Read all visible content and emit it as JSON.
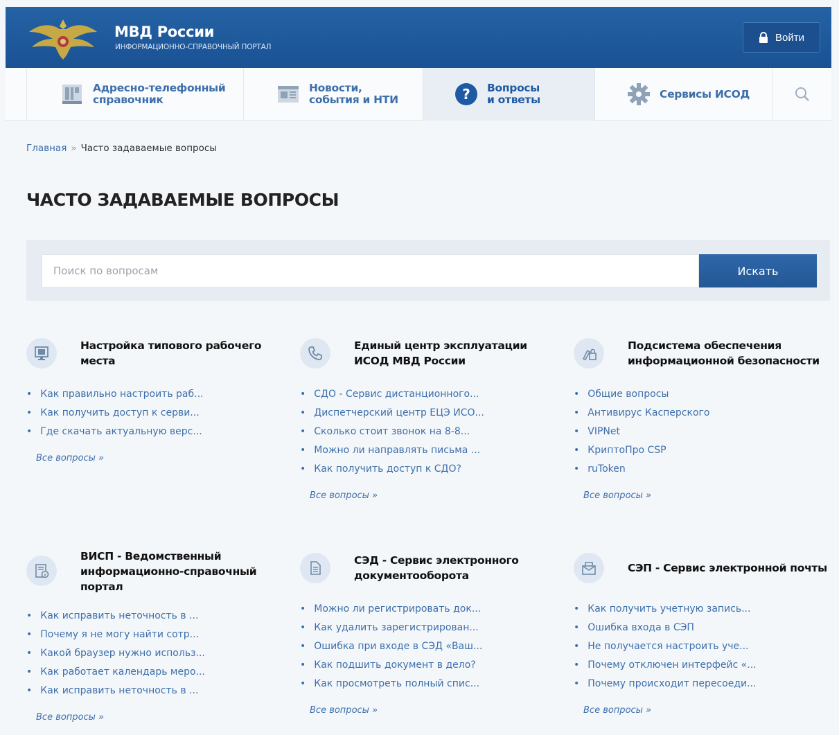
{
  "header": {
    "title": "МВД России",
    "subtitle": "ИНФОРМАЦИОННО-СПРАВОЧНЫЙ ПОРТАЛ",
    "login_label": "Войти",
    "brand_color": "#1a5294"
  },
  "nav": {
    "items": [
      {
        "label_line1": "Адресно-телефонный",
        "label_line2": "справочник",
        "icon": "building-icon"
      },
      {
        "label_line1": "Новости,",
        "label_line2": "события и НТИ",
        "icon": "newspaper-icon"
      },
      {
        "label_line1": "Вопросы",
        "label_line2": "и ответы",
        "icon": "question-icon",
        "active": true
      },
      {
        "label_line1": "Сервисы ИСОД",
        "label_line2": "",
        "icon": "gear-icon"
      }
    ],
    "search_icon": "search-icon"
  },
  "breadcrumb": {
    "home": "Главная",
    "separator": "»",
    "current": "Часто задаваемые вопросы"
  },
  "page_title": "ЧАСТО ЗАДАВАЕМЫЕ ВОПРОСЫ",
  "search": {
    "placeholder": "Поиск по вопросам",
    "button_label": "Искать"
  },
  "categories": [
    {
      "title": "Настройка типового рабочего места",
      "icon": "monitor-icon",
      "questions": [
        "Как правильно настроить раб...",
        "Как получить доступ к серви...",
        "Где скачать актуальную верс..."
      ],
      "all_label": "Все вопросы »"
    },
    {
      "title": "Единый центр эксплуатации ИСОД МВД России",
      "icon": "phone-icon",
      "questions": [
        "СДО - Сервис дистанционного...",
        "Диспетчерский центр ЕЦЭ ИСО...",
        "Сколько стоит звонок на 8-8...",
        "Можно ли направлять письма ...",
        "Как получить доступ к СДО?"
      ],
      "all_label": "Все вопросы »"
    },
    {
      "title": "Подсистема обеспечения информационной безопасности",
      "icon": "security-icon",
      "questions": [
        "Общие вопросы",
        "Антивирус Касперского",
        "VIPNet",
        "КриптоПро CSP",
        "ruToken"
      ],
      "all_label": "Все вопросы »"
    },
    {
      "title": "ВИСП - Ведомственный информационно-справочный портал",
      "icon": "portal-info-icon",
      "questions": [
        "Как исправить неточность в ...",
        "Почему я не могу найти сотр...",
        "Какой браузер нужно использ...",
        "Как работает календарь меро...",
        "Как исправить неточность в ..."
      ],
      "all_label": "Все вопросы »"
    },
    {
      "title": "СЭД - Сервис электронного документооборота",
      "icon": "document-icon",
      "questions": [
        "Можно ли регистрировать док...",
        "Как удалить зарегистрирован...",
        "Ошибка при входе в СЭД «Ваш...",
        "Как подшить документ в дело?",
        "Как просмотреть полный спис..."
      ],
      "all_label": "Все вопросы »"
    },
    {
      "title": "СЭП - Сервис электронной почты",
      "icon": "mail-icon",
      "questions": [
        "Как получить учетную запись...",
        "Ошибка входа в СЭП",
        "Не получается настроить уче...",
        "Почему отключен интерфейс «...",
        "Почему происходит пересоеди..."
      ],
      "all_label": "Все вопросы »"
    }
  ]
}
